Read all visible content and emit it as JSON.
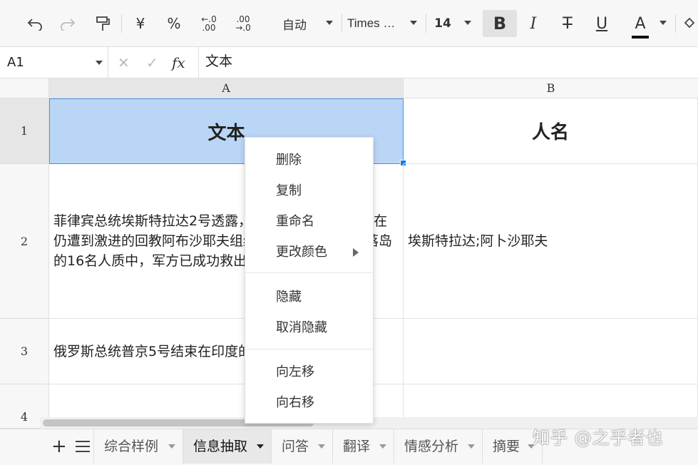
{
  "toolbar": {
    "undo_icon": "undo-icon",
    "currency": "¥",
    "percent": "%",
    "dec_decrease": "←.0\n.00",
    "dec_increase": ".00\n→.0",
    "number_format": "自动",
    "font_name": "Times …",
    "font_size": "14",
    "bold": "B",
    "italic": "I",
    "strike": "T",
    "underline": "U",
    "font_color": "A"
  },
  "formula_bar": {
    "cell_ref": "A1",
    "cancel": "✕",
    "confirm": "✓",
    "fx": "fx",
    "content": "文本"
  },
  "columns": [
    "A",
    "B"
  ],
  "rows": [
    "1",
    "2",
    "3",
    "4"
  ],
  "cells": {
    "A1": "文本",
    "B1": "人名",
    "A2": "菲律宾总统埃斯特拉达2号透露，军方高层已宣布说，在仍遭到激进的回教阿布沙耶夫组织关押在菲国南部和落岛的16名人质中，军方已成功救出了11名菲律宾人质。",
    "B2": "埃斯特拉达;阿卜沙耶夫",
    "A3": "俄罗斯总统普京5号结束在印度的访问回到莫斯科。",
    "B3": "",
    "A4": "",
    "B4": ""
  },
  "context_menu": {
    "items": [
      {
        "label": "删除"
      },
      {
        "label": "复制"
      },
      {
        "label": "重命名"
      },
      {
        "label": "更改颜色"
      },
      {
        "label": "隐藏"
      },
      {
        "label": "取消隐藏"
      },
      {
        "label": "向左移"
      },
      {
        "label": "向右移"
      }
    ]
  },
  "sheet_tabs": [
    {
      "label": "综合样例"
    },
    {
      "label": "信息抽取"
    },
    {
      "label": "问答"
    },
    {
      "label": "翻译"
    },
    {
      "label": "情感分析"
    },
    {
      "label": "摘要"
    }
  ],
  "watermark": "知乎 @之乎者也",
  "colors": {
    "selection_fill": "#bad6f6",
    "selection_border": "#4a90e2",
    "toolbar_bg": "#f7f7f7"
  }
}
